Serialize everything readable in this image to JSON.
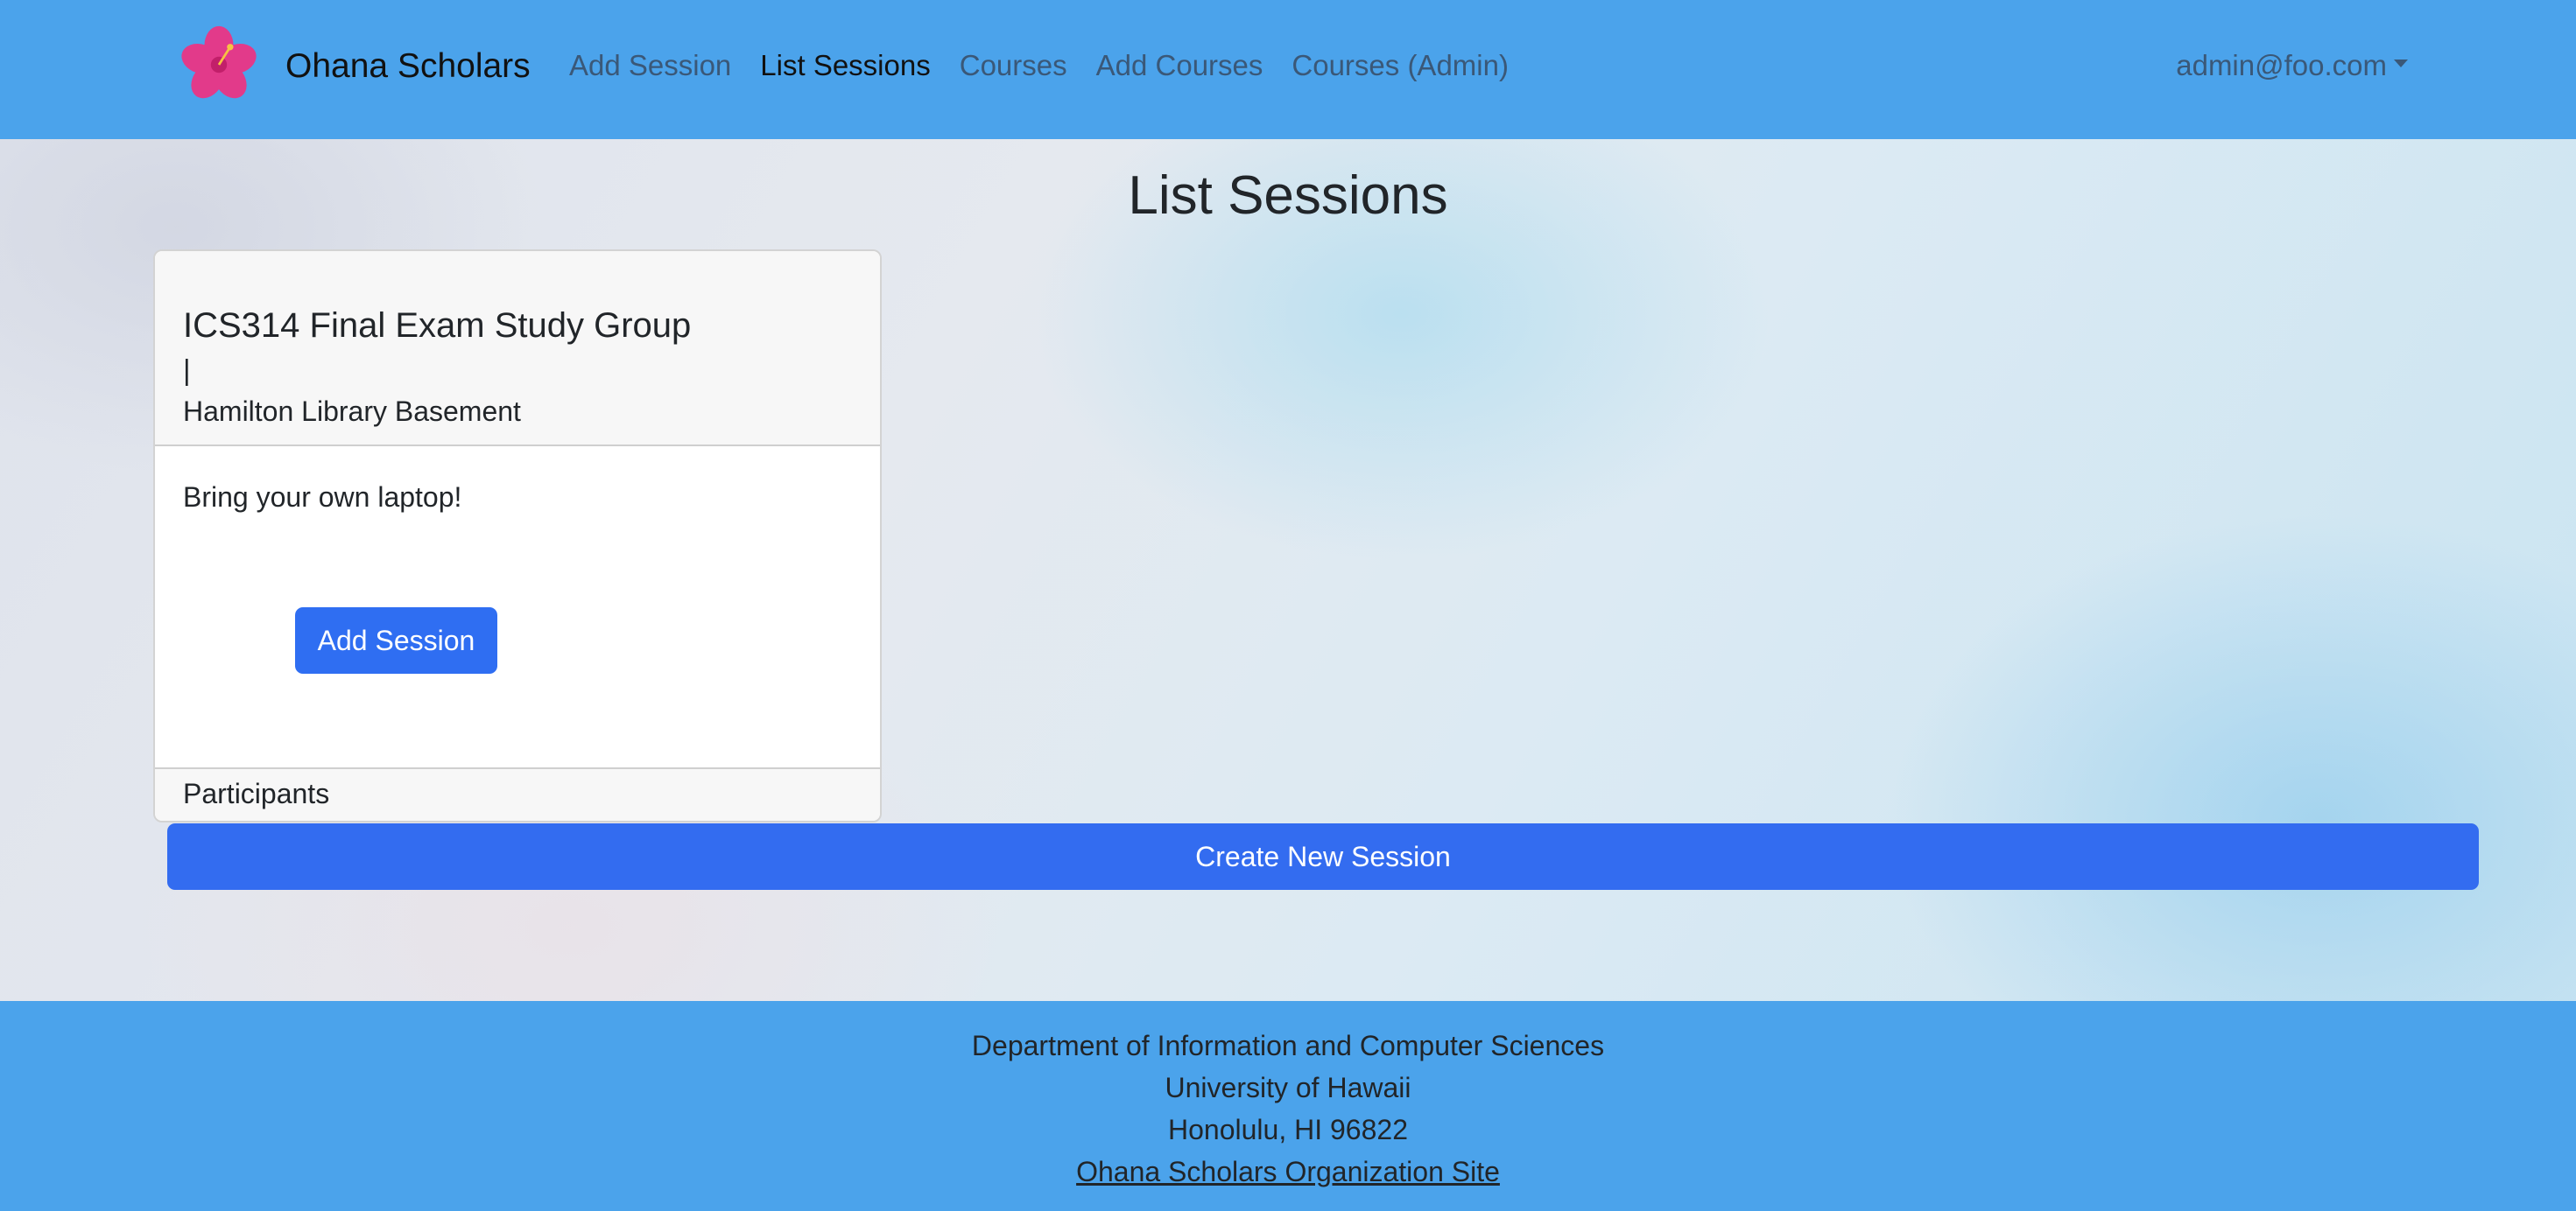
{
  "navbar": {
    "brand": "Ohana Scholars",
    "logo_icon": "hibiscus-icon",
    "links": [
      {
        "label": "Add Session"
      },
      {
        "label": "List Sessions"
      },
      {
        "label": "Courses"
      },
      {
        "label": "Add Courses"
      },
      {
        "label": "Courses (Admin)"
      }
    ],
    "active_link": "List Sessions",
    "user": "admin@foo.com"
  },
  "main": {
    "title": "List Sessions",
    "session_card": {
      "title": "ICS314 Final Exam Study Group",
      "separator": "|",
      "location": "Hamilton Library Basement",
      "description": "Bring your own laptop!",
      "add_button": "Add Session",
      "footer": "Participants"
    },
    "create_button": "Create New Session"
  },
  "footer": {
    "line1": "Department of Information and Computer Sciences",
    "line2": "University of Hawaii",
    "line3": "Honolulu, HI 96822",
    "link": "Ohana Scholars Organization Site"
  },
  "colors": {
    "navbar_bg": "#4ba3eb",
    "primary_button": "#2f6ef2",
    "footer_bg": "#4ba3eb"
  }
}
